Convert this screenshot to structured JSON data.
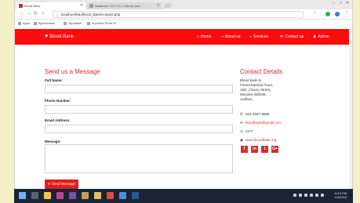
{
  "browser": {
    "tabs": [
      {
        "title": "Blood Bank",
        "active": true
      },
      {
        "title": "localhost / 127.0.0.1 / blood_bar...",
        "active": false
      }
    ],
    "url": "localhost/ML/Blood_Bank/contact.php",
    "bookmarks": [
      "Apps",
      "Bjortzonsen",
      "TopMaker",
      "Imported From IE"
    ]
  },
  "site": {
    "brand": "Blood Bank",
    "nav": [
      {
        "label": "Home",
        "icon": "home-icon"
      },
      {
        "label": "About us",
        "icon": "info-icon"
      },
      {
        "label": "Services",
        "icon": "briefcase-icon"
      },
      {
        "label": "Contact us",
        "icon": "envelope-icon"
      },
      {
        "label": "Admin",
        "icon": "user-icon"
      }
    ],
    "accent": "#ff0b0b"
  },
  "form": {
    "heading": "Send us a Message",
    "full_name_label": "Full Name:",
    "phone_label": "Phone Number:",
    "email_label": "Email Address:",
    "message_label": "Message:",
    "send_label": "Send Message"
  },
  "contact": {
    "heading": "Contact Details",
    "address_lines": [
      "Blood bank &",
      "Friend Medical Trust,",
      "19/2 ,Charry Street,",
      "Mumbai-400035,",
      "Andheri."
    ],
    "phone": "022-2567-9988",
    "email": "bloodbank@gmail.com",
    "hours": "24*7",
    "website": "www.bloodbank.org",
    "social": [
      "f",
      "in",
      "t",
      "G+"
    ]
  },
  "taskbar": {
    "time": "8:15 PM",
    "date": "1/5/2018"
  }
}
